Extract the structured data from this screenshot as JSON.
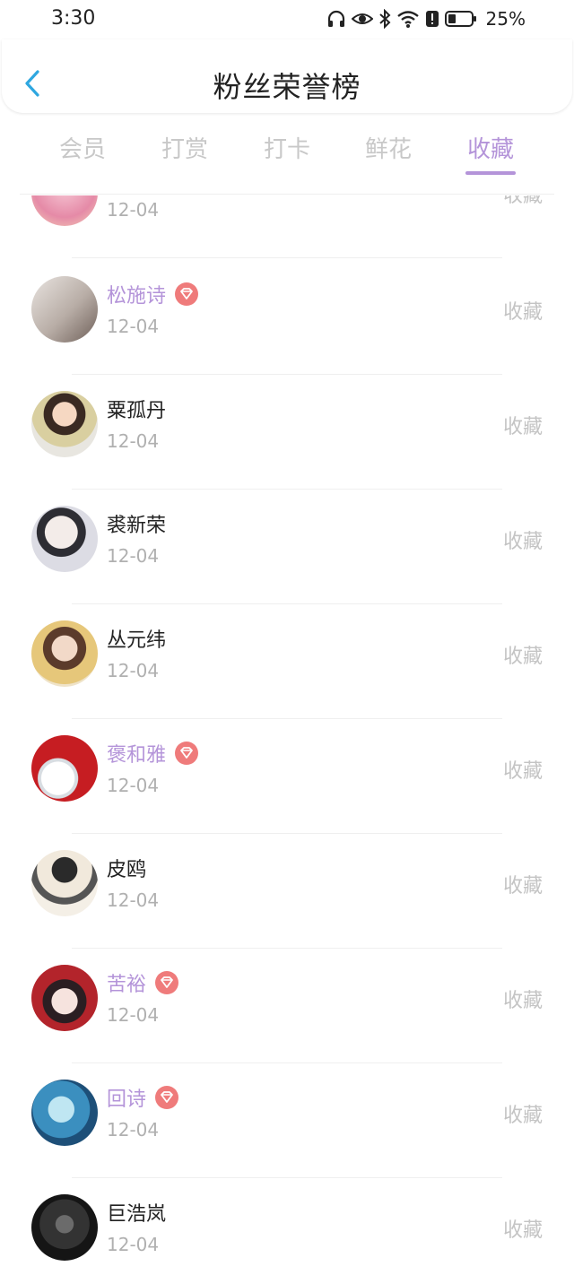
{
  "status_bar": {
    "time": "3:30",
    "battery": "25%"
  },
  "header": {
    "title": "粉丝荣誉榜"
  },
  "tabs": [
    {
      "label": "会员",
      "active": false
    },
    {
      "label": "打赏",
      "active": false
    },
    {
      "label": "打卡",
      "active": false
    },
    {
      "label": "鲜花",
      "active": false
    },
    {
      "label": "收藏",
      "active": true
    }
  ],
  "colors": {
    "accent": "#b494d9",
    "badge": "#ef7b7b",
    "muted": "#c4c4c4"
  },
  "list": [
    {
      "name": "",
      "date": "12-04",
      "action": "收藏",
      "vip": false
    },
    {
      "name": "松施诗",
      "date": "12-04",
      "action": "收藏",
      "vip": true
    },
    {
      "name": "粟孤丹",
      "date": "12-04",
      "action": "收藏",
      "vip": false
    },
    {
      "name": "裘新荣",
      "date": "12-04",
      "action": "收藏",
      "vip": false
    },
    {
      "name": "丛元纬",
      "date": "12-04",
      "action": "收藏",
      "vip": false
    },
    {
      "name": "褒和雅",
      "date": "12-04",
      "action": "收藏",
      "vip": true
    },
    {
      "name": "皮鸥",
      "date": "12-04",
      "action": "收藏",
      "vip": false
    },
    {
      "name": "苦裕",
      "date": "12-04",
      "action": "收藏",
      "vip": true
    },
    {
      "name": "回诗",
      "date": "12-04",
      "action": "收藏",
      "vip": true
    },
    {
      "name": "巨浩岚",
      "date": "12-04",
      "action": "收藏",
      "vip": false
    }
  ]
}
